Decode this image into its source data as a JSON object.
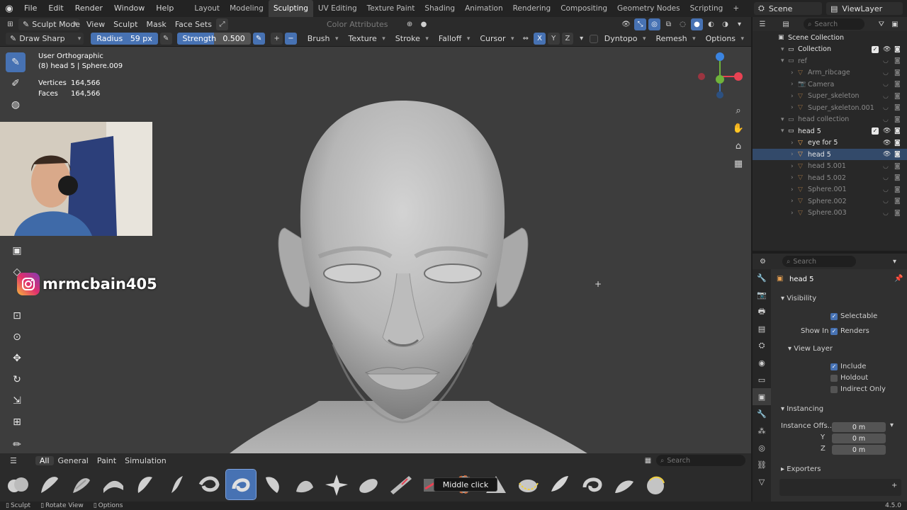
{
  "menu": [
    "File",
    "Edit",
    "Render",
    "Window",
    "Help"
  ],
  "workspaces": [
    "Layout",
    "Modeling",
    "Sculpting",
    "UV Editing",
    "Texture Paint",
    "Shading",
    "Animation",
    "Rendering",
    "Compositing",
    "Geometry Nodes",
    "Scripting"
  ],
  "active_workspace": "Sculpting",
  "scene": "Scene",
  "view_layer": "ViewLayer",
  "viewport_header": {
    "mode": "Sculpt Mode",
    "menus": [
      "View",
      "Sculpt",
      "Mask",
      "Face Sets"
    ],
    "color_attributes": "Color Attributes"
  },
  "tool_header": {
    "brush_name": "Draw Sharp",
    "radius_label": "Radius",
    "radius_value": "59 px",
    "strength_label": "Strength",
    "strength_value": "0.500",
    "menus": [
      "Brush",
      "Texture",
      "Stroke",
      "Falloff",
      "Cursor"
    ],
    "axes": [
      "X",
      "Y",
      "Z"
    ],
    "dyntopo": "Dyntopo",
    "remesh": "Remesh",
    "options": "Options"
  },
  "viewport_info": {
    "view": "User Orthographic",
    "object": "(8) head 5 | Sphere.009",
    "vertices_label": "Vertices",
    "vertices_value": "164,566",
    "faces_label": "Faces",
    "faces_value": "164,566"
  },
  "watermark": "mrmcbain405",
  "shelf_tabs": [
    "All",
    "General",
    "Paint",
    "Simulation"
  ],
  "shelf_search": "Search",
  "tooltip": "Middle click",
  "statusbar": [
    "Sculpt",
    "Rotate View",
    "Options"
  ],
  "version": "4.5.0",
  "outliner": {
    "search_placeholder": "Search",
    "rows": [
      {
        "label": "Scene Collection",
        "indent": 0,
        "type": "scene"
      },
      {
        "label": "Collection",
        "indent": 1,
        "type": "collection"
      },
      {
        "label": "ref",
        "indent": 1,
        "type": "collection",
        "dim": true
      },
      {
        "label": "Arm_ribcage",
        "indent": 2,
        "type": "object",
        "dim": true
      },
      {
        "label": "Camera",
        "indent": 2,
        "type": "camera",
        "dim": true
      },
      {
        "label": "Super_skeleton",
        "indent": 2,
        "type": "object",
        "dim": true
      },
      {
        "label": "Super_skeleton.001",
        "indent": 2,
        "type": "object",
        "dim": true
      },
      {
        "label": "head collection",
        "indent": 1,
        "type": "collection",
        "dim": true
      },
      {
        "label": "head 5",
        "indent": 1,
        "type": "collection"
      },
      {
        "label": "eye for 5",
        "indent": 2,
        "type": "object"
      },
      {
        "label": "head 5",
        "indent": 2,
        "type": "object",
        "selected": true
      },
      {
        "label": "head 5.001",
        "indent": 2,
        "type": "object",
        "dim": true
      },
      {
        "label": "head 5.002",
        "indent": 2,
        "type": "object",
        "dim": true
      },
      {
        "label": "Sphere.001",
        "indent": 2,
        "type": "object",
        "dim": true
      },
      {
        "label": "Sphere.002",
        "indent": 2,
        "type": "object",
        "dim": true
      },
      {
        "label": "Sphere.003",
        "indent": 2,
        "type": "object",
        "dim": true
      }
    ]
  },
  "properties": {
    "search_placeholder": "Search",
    "object_name": "head 5",
    "visibility": "Visibility",
    "selectable": "Selectable",
    "show_in": "Show In",
    "renders": "Renders",
    "view_layer": "View Layer",
    "include": "Include",
    "holdout": "Holdout",
    "indirect_only": "Indirect Only",
    "instancing": "Instancing",
    "instance_offset_label": "Instance Offs...",
    "offset_x": "0 m",
    "y_label": "Y",
    "offset_y": "0 m",
    "z_label": "Z",
    "offset_z": "0 m",
    "exporters": "Exporters"
  },
  "colors": {
    "accent": "#4772b3",
    "viewport_bg": "#3d3d3d",
    "panel_bg": "#303030"
  }
}
